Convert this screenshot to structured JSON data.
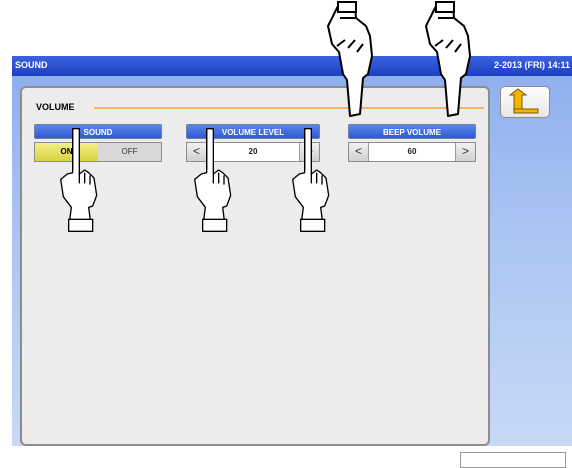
{
  "window": {
    "title": "SOUND",
    "datetime": "2-2013 (FRI) 14:11"
  },
  "volume_group": {
    "label": "VOLUME",
    "sound": {
      "label": "SOUND",
      "on_label": "ON",
      "off_label": "OFF",
      "selected": "ON"
    },
    "volume_level": {
      "label": "VOLUME LEVEL",
      "value": "20",
      "left_glyph": "<",
      "right_glyph": ">"
    },
    "beep_volume": {
      "label": "BEEP VOLUME",
      "value": "60",
      "left_glyph": "<",
      "right_glyph": ">"
    }
  },
  "icons": {
    "back": "return-arrow-icon",
    "pointer": "pointing-hand-icon"
  },
  "colors": {
    "titlebar": "#1d3fc3",
    "header_blue": "#2f59cf",
    "side_blue": "#a9c4f2",
    "panel": "#ececec",
    "on_selected": "#d8d241",
    "divider": "#f0b86a"
  }
}
